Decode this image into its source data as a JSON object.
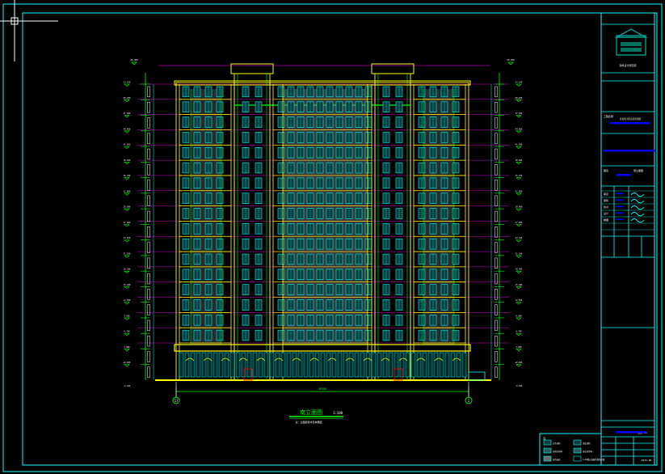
{
  "drawing": {
    "main_title": "南立面图",
    "scale": "1:100",
    "sub_note": "注：立面颜色详见效果图",
    "overall_dim": "48300",
    "axis_left": "17",
    "axis_right": "1",
    "ground_elev": "-0.300",
    "top_elev": "56.400"
  },
  "levels": {
    "left": [
      "53.100",
      "50.200",
      "47.300",
      "44.400",
      "41.500",
      "38.600",
      "35.700",
      "32.800",
      "29.900",
      "27.000",
      "24.100",
      "21.200",
      "18.300",
      "15.400",
      "12.500",
      "9.600",
      "6.700",
      "3.800",
      "±0.000"
    ],
    "right": [
      "53.100",
      "50.200",
      "47.300",
      "44.400",
      "41.500",
      "38.600",
      "35.700",
      "32.800",
      "29.900",
      "27.000",
      "24.100",
      "21.200",
      "18.300",
      "15.400",
      "12.500",
      "9.600",
      "6.700",
      "3.800",
      "±0.000"
    ]
  },
  "title_block": {
    "company": "建筑设计研究院",
    "project_label": "工程名称",
    "project_name": "某住宅小区高层住宅楼",
    "drawing_label": "图名",
    "drawing_name": "南立面图",
    "rows": [
      {
        "role": "审定",
        "name": ""
      },
      {
        "role": "审核",
        "name": ""
      },
      {
        "role": "校对",
        "name": ""
      },
      {
        "role": "设计",
        "name": ""
      },
      {
        "role": "制图",
        "name": ""
      }
    ],
    "sheet_code": "建施-13",
    "date": "2015.06"
  },
  "legend": {
    "title": "注：",
    "items": [
      {
        "label": "白色涂料",
        "swatch": "#1a3a3a"
      },
      {
        "label": "浅灰涂料",
        "swatch": "#1a3a3a"
      },
      {
        "label": "米黄色涂料",
        "swatch": "#2a5a5a"
      },
      {
        "label": "深灰色涂料",
        "swatch": "#2a5a5a"
      },
      {
        "label": "灰色面砖",
        "swatch": "#6a6a6a"
      },
      {
        "label": "3~4#楼立面颜色参照此图",
        "swatch": "#000000"
      }
    ]
  },
  "colors": {
    "frame": "#00ffff",
    "yellow": "#ffff00",
    "green": "#00ff00",
    "cyan": "#00ffff",
    "magenta": "#ff00ff",
    "white": "#ffffff",
    "blue": "#0000ff",
    "red": "#ff0000",
    "grey": "#6a6a6a"
  }
}
